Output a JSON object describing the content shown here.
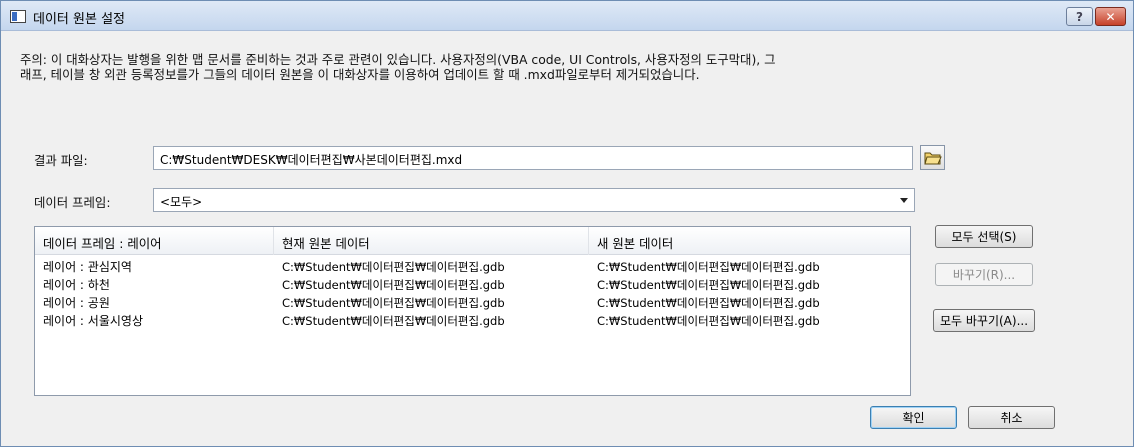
{
  "window": {
    "title": "데이터 원본 설정",
    "help_label": "?",
    "close_label": "✕"
  },
  "notice": {
    "line1": "주의: 이 대화상자는 발행을 위한 맵 문서를 준비하는 것과 주로 관련이 있습니다. 사용자정의(VBA code, UI Controls, 사용자정의 도구막대), 그",
    "line2": "래프, 테이블 창 외관 등록정보를가 그들의 데이터 원본을 이 대화상자를 이용하여 업데이트 할 때 .mxd파일로부터 제거되었습니다."
  },
  "result_file": {
    "label": "결과 파일:",
    "value": "C:₩Student₩DESK₩데이터편집₩사본데이터편집.mxd",
    "browse_icon": "open-folder-icon"
  },
  "data_frame": {
    "label": "데이터 프레임:",
    "selected": "<모두>"
  },
  "list": {
    "columns": [
      "데이터 프레임 : 레이어",
      "현재 원본 데이터",
      "새 원본 데이터"
    ],
    "rows": [
      [
        "레이어 : 관심지역",
        "C:₩Student₩데이터편집₩데이터편집.gdb",
        "C:₩Student₩데이터편집₩데이터편집.gdb"
      ],
      [
        "레이어 : 하천",
        "C:₩Student₩데이터편집₩데이터편집.gdb",
        "C:₩Student₩데이터편집₩데이터편집.gdb"
      ],
      [
        "레이어 : 공원",
        "C:₩Student₩데이터편집₩데이터편집.gdb",
        "C:₩Student₩데이터편집₩데이터편집.gdb"
      ],
      [
        "레이어 : 서울시영상",
        "C:₩Student₩데이터편집₩데이터편집.gdb",
        "C:₩Student₩데이터편집₩데이터편집.gdb"
      ]
    ]
  },
  "buttons": {
    "select_all": "모두 선택(S)",
    "replace": "바꾸기(R)...",
    "replace_all": "모두 바꾸기(A)...",
    "ok": "확인",
    "cancel": "취소"
  }
}
